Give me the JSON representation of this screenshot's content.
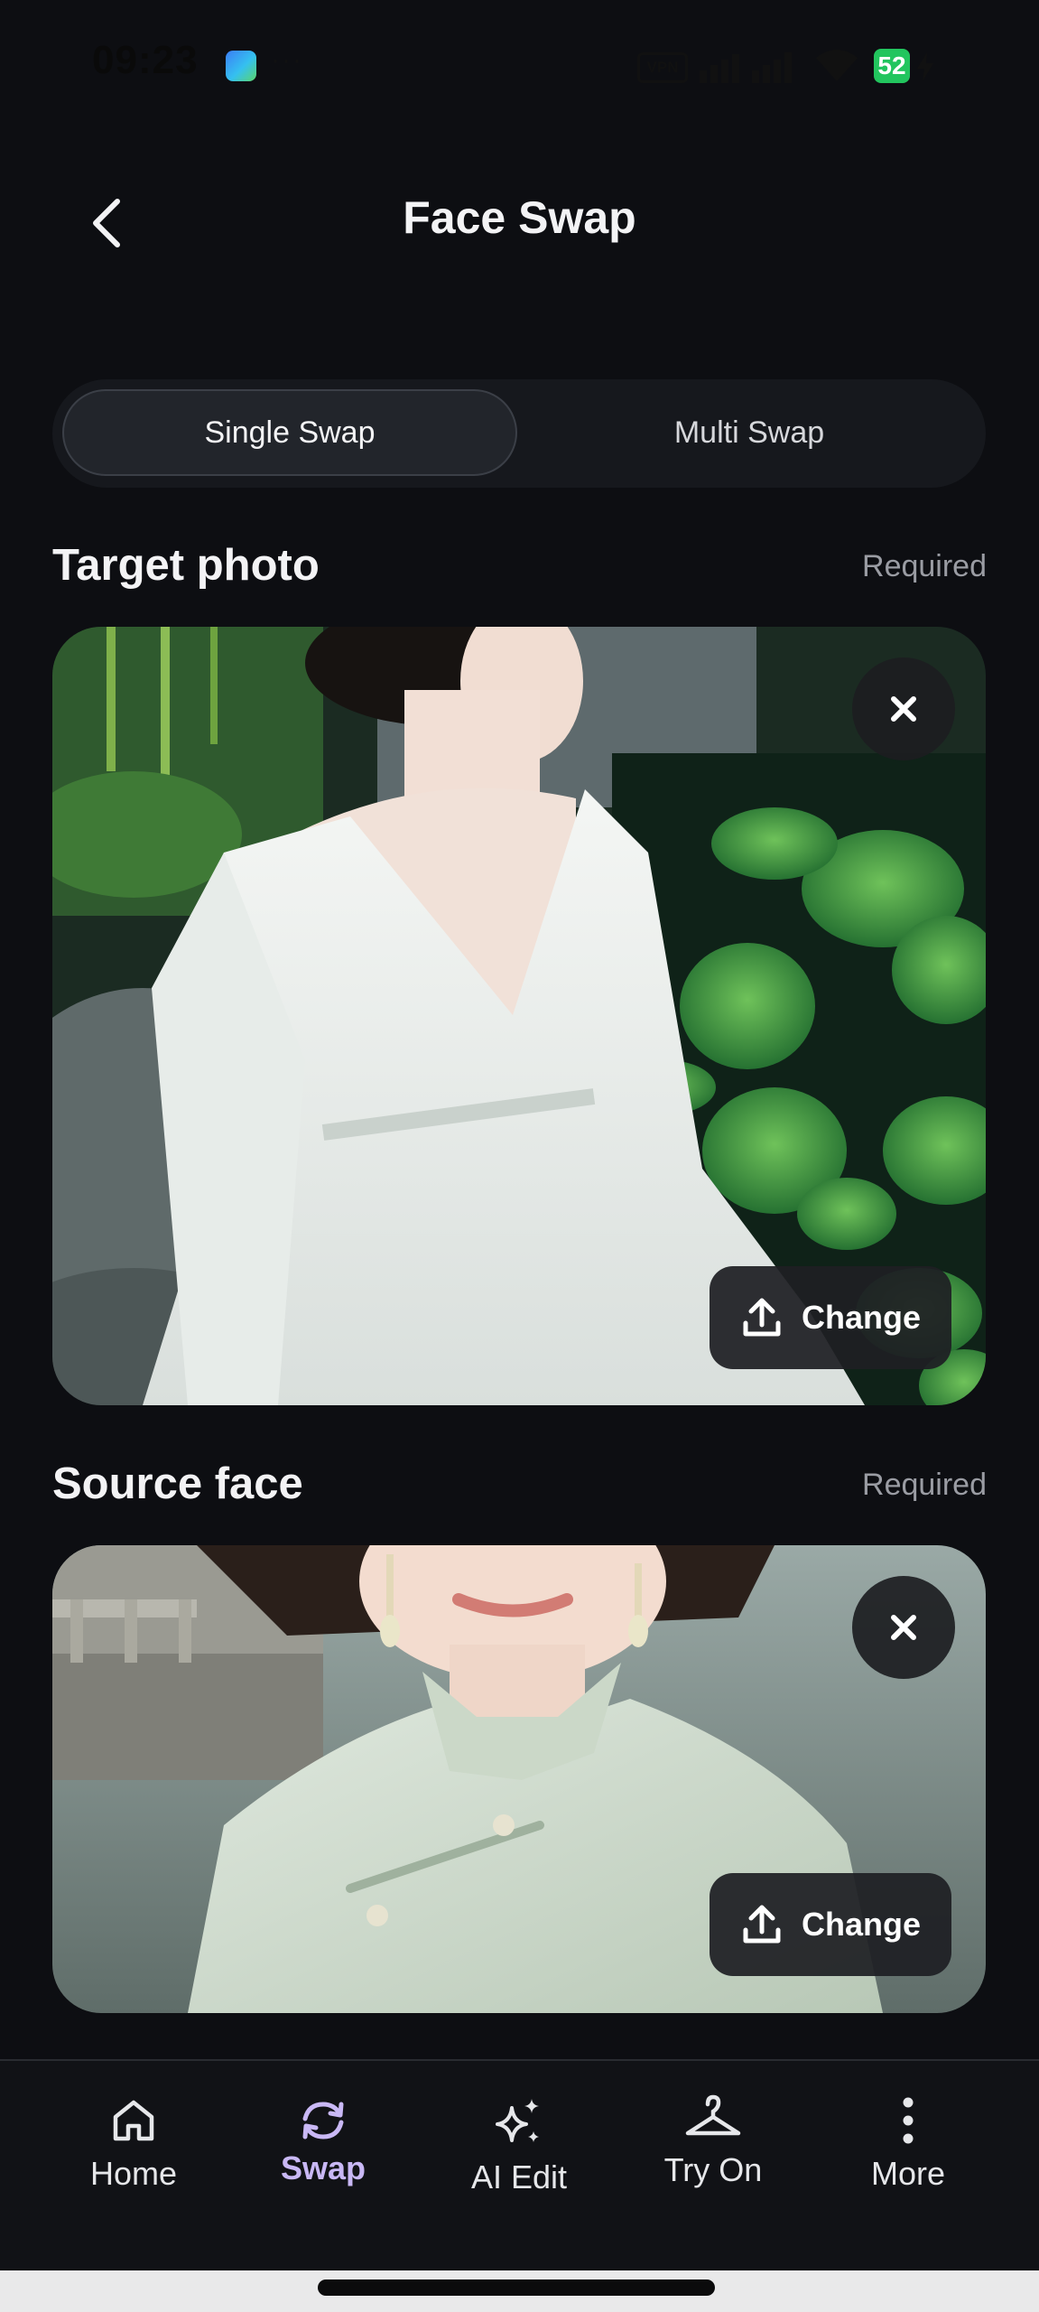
{
  "status_bar": {
    "time": "09:23",
    "dots": "···",
    "vpn": "VPN",
    "battery": "52"
  },
  "header": {
    "title": "Face Swap",
    "back_icon": "chevron-left-icon"
  },
  "tabs": [
    {
      "label": "Single Swap",
      "active": true
    },
    {
      "label": "Multi Swap",
      "active": false
    }
  ],
  "sections": {
    "target": {
      "title": "Target photo",
      "badge": "Required",
      "change_label": "Change"
    },
    "source": {
      "title": "Source face",
      "badge": "Required",
      "change_label": "Change"
    }
  },
  "bottom_nav": [
    {
      "label": "Home",
      "icon": "home-icon",
      "active": false
    },
    {
      "label": "Swap",
      "icon": "swap-refresh-icon",
      "active": true
    },
    {
      "label": "AI Edit",
      "icon": "sparkle-icon",
      "active": false
    },
    {
      "label": "Try On",
      "icon": "hanger-icon",
      "active": false
    },
    {
      "label": "More",
      "icon": "more-vertical-icon",
      "active": false
    }
  ],
  "colors": {
    "background": "#0d0e12",
    "active_nav": "#c9b8f5",
    "battery": "#22c55e"
  }
}
